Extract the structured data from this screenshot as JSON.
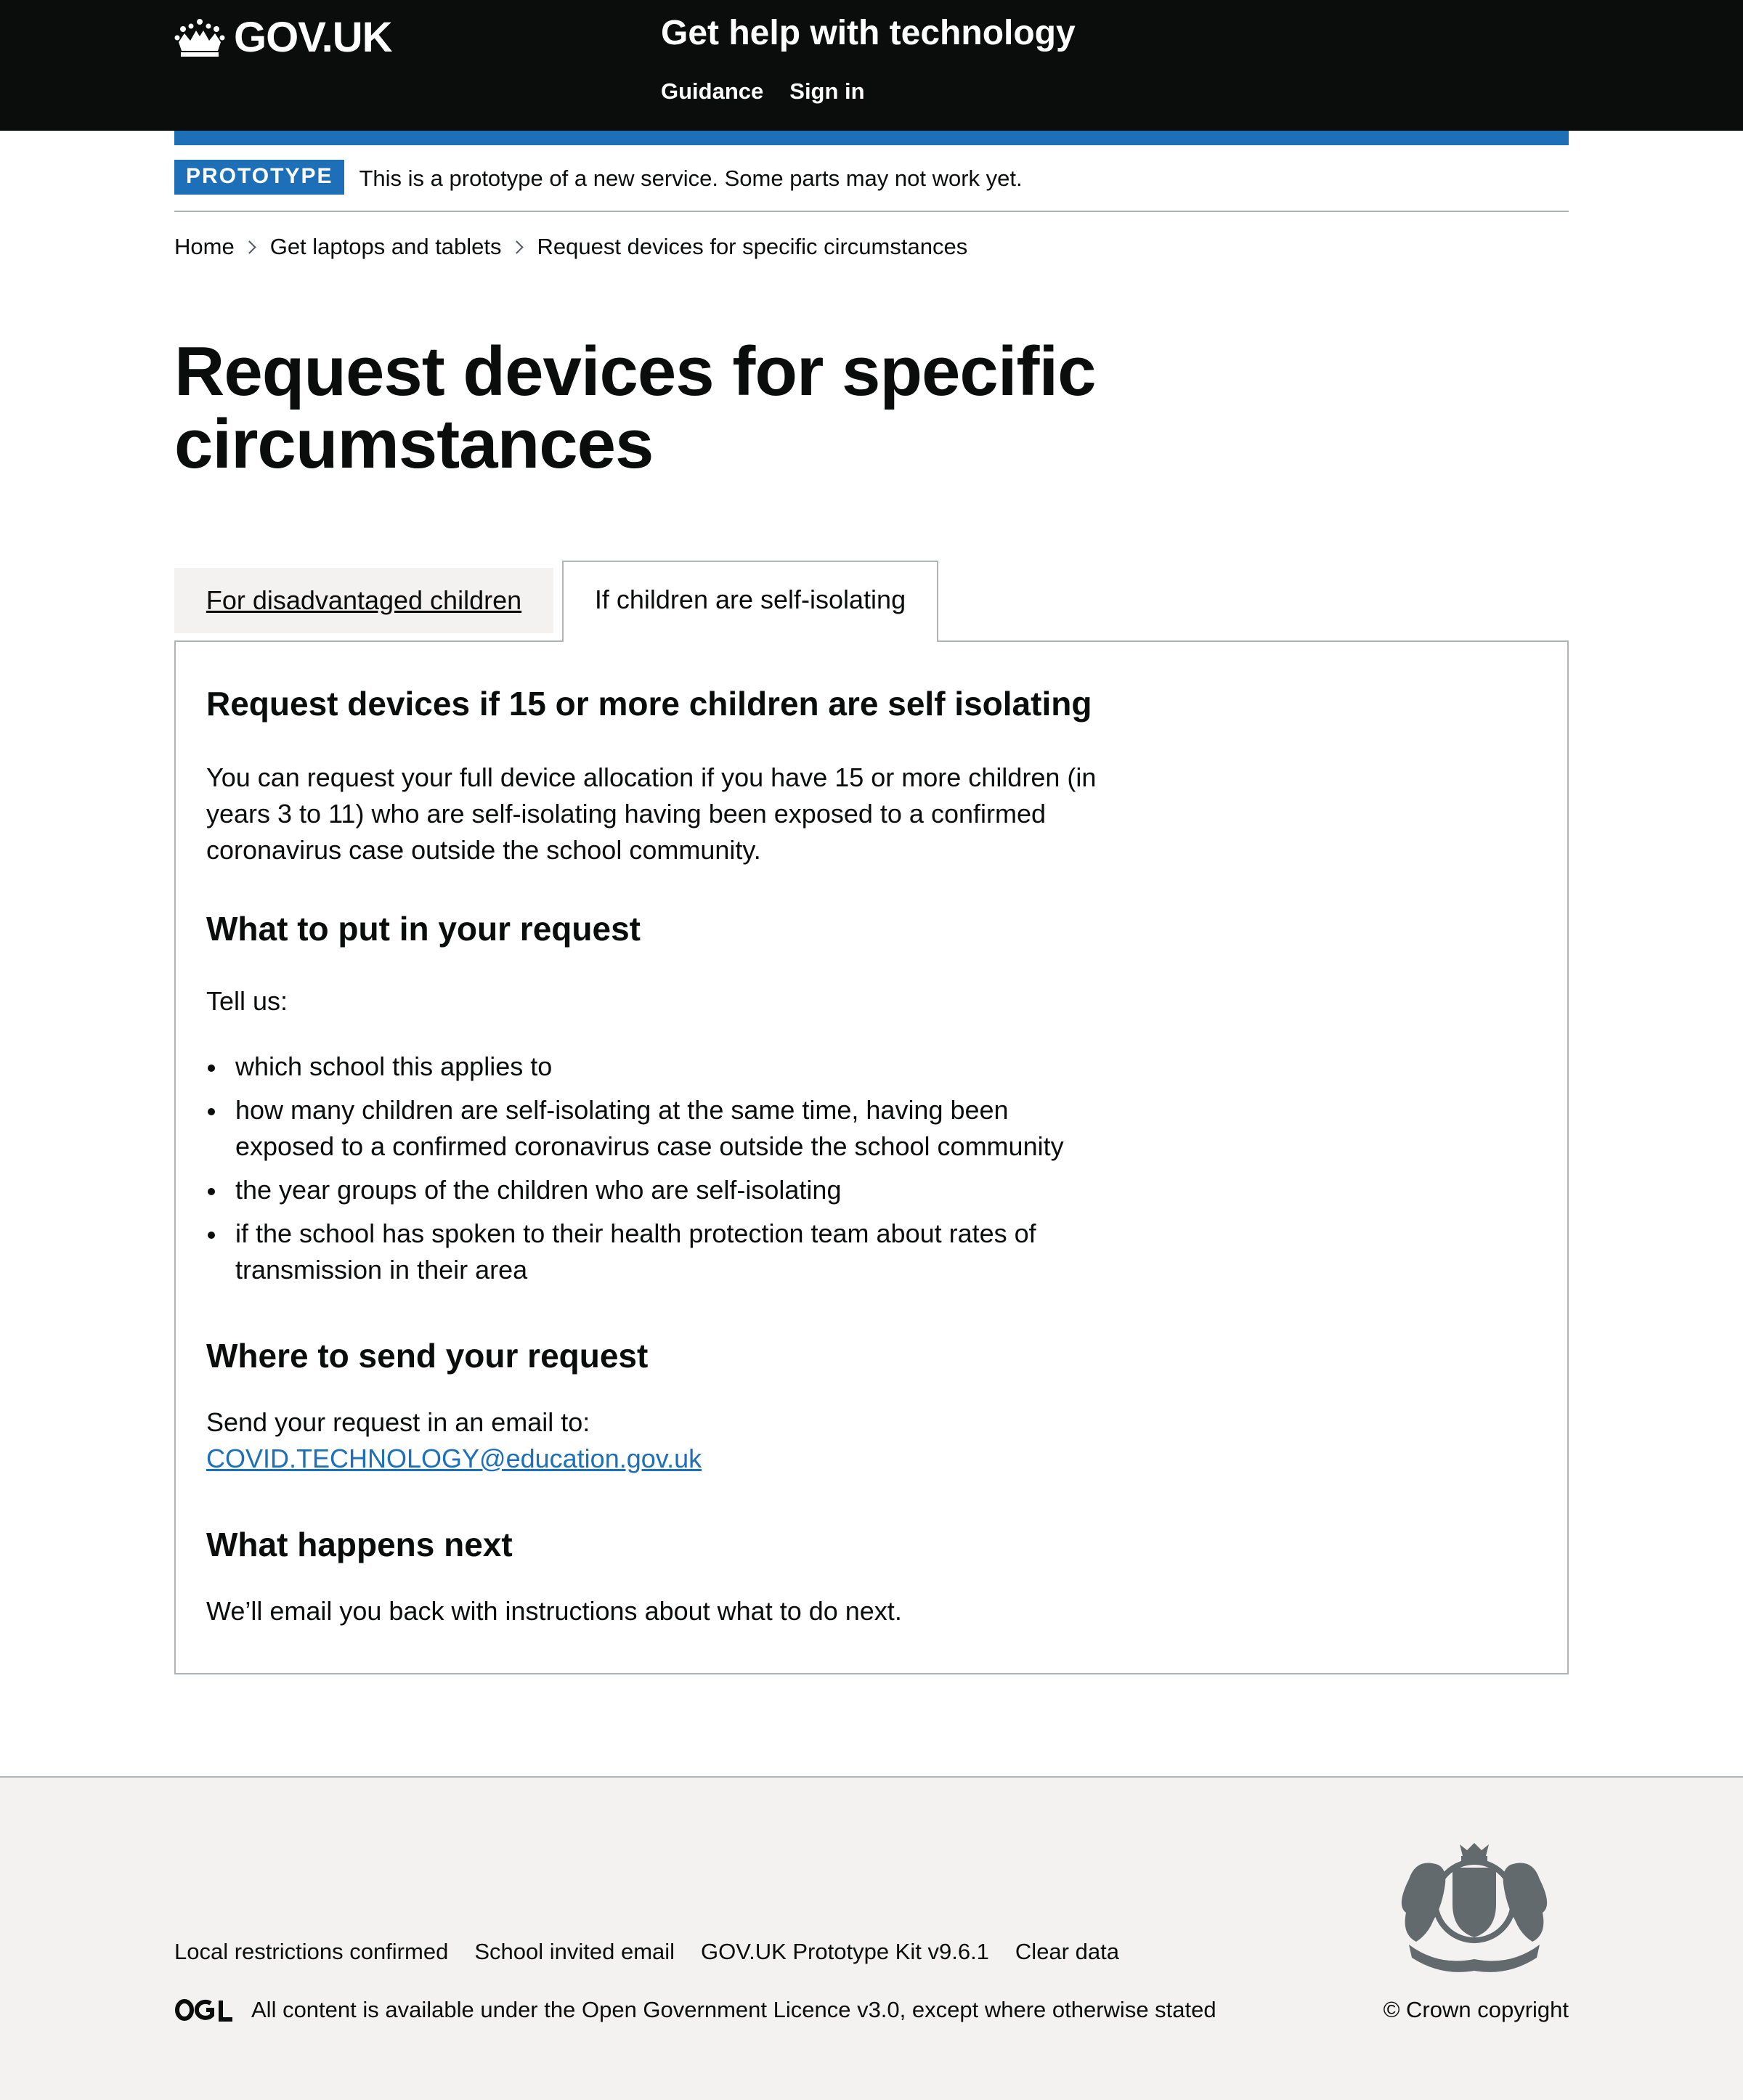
{
  "header": {
    "logo_text": "GOV.UK",
    "service_name": "Get help with technology",
    "nav": [
      {
        "label": "Guidance"
      },
      {
        "label": "Sign in"
      }
    ]
  },
  "phase_banner": {
    "tag": "PROTOTYPE",
    "text": "This is a prototype of a new service. Some parts may not work yet."
  },
  "breadcrumbs": [
    {
      "label": "Home"
    },
    {
      "label": "Get laptops and tablets"
    },
    {
      "label": "Request devices for specific circumstances"
    }
  ],
  "page_title": "Request devices for specific circumstances",
  "tabs": [
    {
      "label": "For disadvantaged children"
    },
    {
      "label": "If children are self-isolating"
    }
  ],
  "panel": {
    "heading": "Request devices if 15 or more children are self isolating",
    "intro": "You can request your full device allocation if you have 15 or more children (in years 3 to 11) who are self-isolating having been exposed to a confirmed coronavirus case outside the school community.",
    "section_1": {
      "heading": "What to put in your request",
      "lead": "Tell us:",
      "items": [
        "which school this applies to",
        "how many children are self-isolating at the same time, having been exposed to a confirmed coronavirus case outside the school community",
        "the year groups of the children who are self-isolating",
        "if the school has spoken to their health protection team about rates of transmission in their area"
      ]
    },
    "section_2": {
      "heading": "Where to send your request",
      "text": "Send your request in an email to:",
      "email": "COVID.TECHNOLOGY@education.gov.uk"
    },
    "section_3": {
      "heading": "What happens next",
      "text": "We’ll email you back with instructions about what to do next."
    }
  },
  "footer": {
    "links": [
      {
        "label": "Local restrictions confirmed"
      },
      {
        "label": "School invited email"
      },
      {
        "label": "GOV.UK Prototype Kit v9.6.1"
      },
      {
        "label": "Clear data"
      }
    ],
    "licence_prefix": "All content is available under the",
    "licence_link": "Open Government Licence v3.0",
    "licence_suffix": ", except where otherwise stated",
    "copyright": "© Crown copyright"
  },
  "colors": {
    "header_bg": "#0b0c0c",
    "brand_blue": "#1d70b8",
    "footer_bg": "#f3f2f1",
    "border_grey": "#b1b4b6"
  }
}
